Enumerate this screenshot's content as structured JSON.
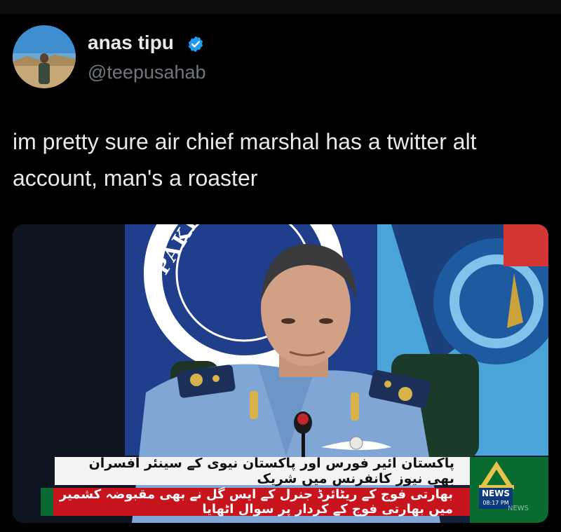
{
  "tweet": {
    "author": {
      "display_name": "anas tipu",
      "handle": "@teepusahab",
      "verified": true,
      "verified_color": "#1d9bf0"
    },
    "text": "im pretty sure air chief marshal has a twitter alt account, man's a roaster",
    "media": {
      "flag_lettering": "PAKISTAN NAVY",
      "ticker_headline": "پاکستان ائیر فورس اور پاکستان نیوی کے سینئر افسران بھی نیوز کانفرنس میں شریک",
      "ticker_breaking": "بھارتی فوج کے ریٹائرڈ جنرل کے ایس گل نے بھی مقبوضہ کشمیر میں بھارتی فوج کے کردار پر سوال اٹھایا",
      "news_badge_label": "NEWS",
      "news_badge_time": "08:17 PM",
      "corner_watermark": "NEWS",
      "colors": {
        "ticker_white": "#f4f4f4",
        "ticker_red": "#c8141c",
        "ptv_green": "#0a6b32"
      }
    }
  }
}
